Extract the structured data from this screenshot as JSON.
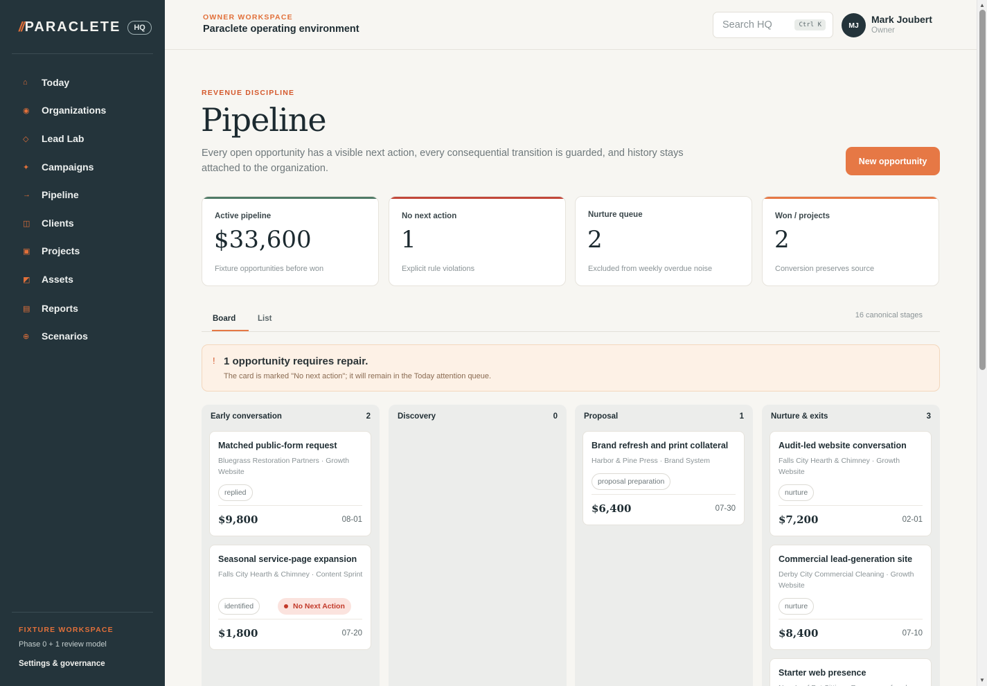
{
  "sidebar": {
    "brand_name": "PARACLETE",
    "brand_badge": "HQ",
    "items": [
      {
        "label": "Today",
        "icon": "home-icon",
        "glyph": "⌂"
      },
      {
        "label": "Organizations",
        "icon": "organizations-icon",
        "glyph": "◉"
      },
      {
        "label": "Lead Lab",
        "icon": "lead-lab-icon",
        "glyph": "◇"
      },
      {
        "label": "Campaigns",
        "icon": "campaigns-icon",
        "glyph": "✦"
      },
      {
        "label": "Pipeline",
        "icon": "pipeline-arrow-icon",
        "glyph": "→"
      },
      {
        "label": "Clients",
        "icon": "clients-icon",
        "glyph": "◫"
      },
      {
        "label": "Projects",
        "icon": "projects-icon",
        "glyph": "▣"
      },
      {
        "label": "Assets",
        "icon": "assets-icon",
        "glyph": "◩"
      },
      {
        "label": "Reports",
        "icon": "reports-icon",
        "glyph": "▤"
      },
      {
        "label": "Scenarios",
        "icon": "scenarios-icon",
        "glyph": "⊕"
      }
    ],
    "footer_title": "FIXTURE WORKSPACE",
    "footer_sub": "Phase 0 + 1 review model",
    "settings_label": "Settings & governance"
  },
  "header": {
    "kicker": "OWNER WORKSPACE",
    "title": "Paraclete operating environment",
    "search_placeholder": "Search HQ",
    "search_shortcut": "Ctrl K",
    "user_initials": "MJ",
    "user_name": "Mark Joubert",
    "user_role": "Owner"
  },
  "page": {
    "kicker": "REVENUE DISCIPLINE",
    "title": "Pipeline",
    "description": "Every open opportunity has a visible next action, every consequential transition is guarded, and history stays attached to the organization.",
    "new_button": "New opportunity"
  },
  "stats": [
    {
      "label": "Active pipeline",
      "value": "$33,600",
      "note": "Fixture opportunities before won",
      "accent": "#4f7a66"
    },
    {
      "label": "No next action",
      "value": "1",
      "note": "Explicit rule violations",
      "accent": "#c2473a"
    },
    {
      "label": "Nurture queue",
      "value": "2",
      "note": "Excluded from weekly overdue noise",
      "accent": "#ffffff"
    },
    {
      "label": "Won / projects",
      "value": "2",
      "note": "Conversion preserves source",
      "accent": "#e67845"
    }
  ],
  "tabs": {
    "board": "Board",
    "list": "List",
    "stages_note": "16 canonical stages"
  },
  "alert": {
    "icon": "!",
    "title": "1 opportunity requires repair.",
    "text": "The card is marked \"No next action\"; it will remain in the Today attention queue."
  },
  "columns": [
    {
      "title": "Early conversation",
      "count": "2",
      "cards": [
        {
          "title": "Matched public-form request",
          "sub": "Bluegrass Restoration Partners · Growth Website",
          "chip": "replied",
          "alert": "",
          "amount": "$9,800",
          "date": "08-01"
        },
        {
          "title": "Seasonal service-page expansion",
          "sub": "Falls City Hearth & Chimney · Content Sprint",
          "chip": "identified",
          "alert": "No Next Action",
          "amount": "$1,800",
          "date": "07-20"
        }
      ]
    },
    {
      "title": "Discovery",
      "count": "0",
      "cards": []
    },
    {
      "title": "Proposal",
      "count": "1",
      "cards": [
        {
          "title": "Brand refresh and print collateral",
          "sub": "Harbor & Pine Press · Brand System",
          "chip": "proposal preparation",
          "alert": "",
          "amount": "$6,400",
          "date": "07-30"
        }
      ]
    },
    {
      "title": "Nurture & exits",
      "count": "3",
      "cards": [
        {
          "title": "Audit-led website conversation",
          "sub": "Falls City Hearth & Chimney · Growth Website",
          "chip": "nurture",
          "alert": "",
          "amount": "$7,200",
          "date": "02-01"
        },
        {
          "title": "Commercial lead-generation site",
          "sub": "Derby City Commercial Cleaning · Growth Website",
          "chip": "nurture",
          "alert": "",
          "amount": "$8,400",
          "date": "07-10"
        },
        {
          "title": "Starter web presence",
          "sub": "New Leaf Pet Sitting · Resource referral",
          "chip": "",
          "alert": "",
          "amount": "",
          "date": ""
        }
      ]
    }
  ]
}
